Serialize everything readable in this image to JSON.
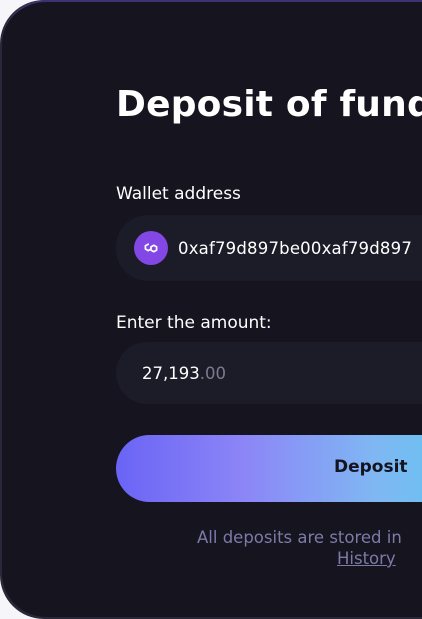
{
  "dialog": {
    "title": "Deposit of funds"
  },
  "wallet": {
    "label": "Wallet address",
    "token_icon": "polygon-icon",
    "address": "0xaf79d897be00xaf79d897"
  },
  "amount": {
    "label": "Enter the amount:",
    "integer_part": "27,193",
    "decimal_part": ".00"
  },
  "actions": {
    "deposit_label": "Deposit"
  },
  "footer": {
    "note": "All deposits are stored in",
    "history_link": "History"
  },
  "colors": {
    "panel_background": "#15141f",
    "field_background": "#1c1b28",
    "token_accent": "#8247e5",
    "muted_text": "#7d7aa8",
    "button_gradient_start": "#6a64f6",
    "button_gradient_end": "#5cc7ef"
  }
}
